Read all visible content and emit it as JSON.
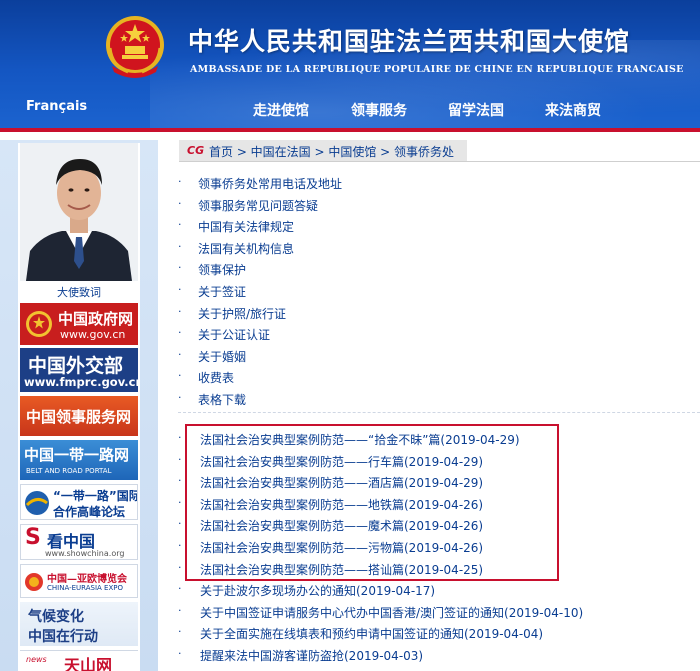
{
  "header": {
    "title_cn": "中华人民共和国驻法兰西共和国大使馆",
    "title_fr": "AMBASSADE DE LA REPUBLIQUE POPULAIRE DE CHINE EN REPUBLIQUE FRANCAISE",
    "language_link": "Français",
    "nav": [
      "走进使馆",
      "领事服务",
      "留学法国",
      "来法商贸"
    ]
  },
  "sidebar": {
    "photo_caption": "大使致词",
    "banners": [
      {
        "line1": "中国政府网",
        "line2": "www.gov.cn"
      },
      {
        "line1": "中国外交部",
        "line2": "www.fmprc.gov.cn"
      },
      {
        "line1": "中国领事服务网",
        "line2": ""
      },
      {
        "line1": "中国一带一路网",
        "line2": "BELT AND ROAD PORTAL"
      },
      {
        "line1": "“一带一路”国际",
        "line2": "合作高峰论坛"
      },
      {
        "line1": "看中国",
        "line2": "www.showchina.org"
      },
      {
        "line1": "中国—亚欧博览会",
        "line2": "CHINA-EURASIA EXPO"
      },
      {
        "line1": "气候变化",
        "line2": "中国在行动"
      },
      {
        "line1": "天山网",
        "line2": "news"
      }
    ]
  },
  "breadcrumb": "首页 > 中国在法国 > 中国使馆 > 领事侨务处",
  "links": [
    "领事侨务处常用电话及地址",
    "领事服务常见问题答疑",
    "中国有关法律规定",
    "法国有关机构信息",
    "领事保护",
    "关于签证",
    "关于护照/旅行证",
    "关于公证认证",
    "关于婚姻",
    "收费表",
    "表格下载"
  ],
  "news": [
    "法国社会治安典型案例防范——“拾金不昧”篇(2019-04-29)",
    "法国社会治安典型案例防范——行车篇(2019-04-29)",
    "法国社会治安典型案例防范——酒店篇(2019-04-29)",
    "法国社会治安典型案例防范——地铁篇(2019-04-26)",
    "法国社会治安典型案例防范——魔术篇(2019-04-26)",
    "法国社会治安典型案例防范——污物篇(2019-04-26)",
    "法国社会治安典型案例防范——搭讪篇(2019-04-25)",
    "关于赴波尔多现场办公的通知(2019-04-17)",
    "关于中国签证申请服务中心代办中国香港/澳门签证的通知(2019-04-10)",
    "关于全面实施在线填表和预约申请中国签证的通知(2019-04-04)",
    "提醒来法中国游客谨防盗抢(2019-04-03)"
  ],
  "colors": {
    "header_blue": "#1456c2",
    "accent_red": "#c8102e",
    "link_blue": "#0a3d91"
  }
}
